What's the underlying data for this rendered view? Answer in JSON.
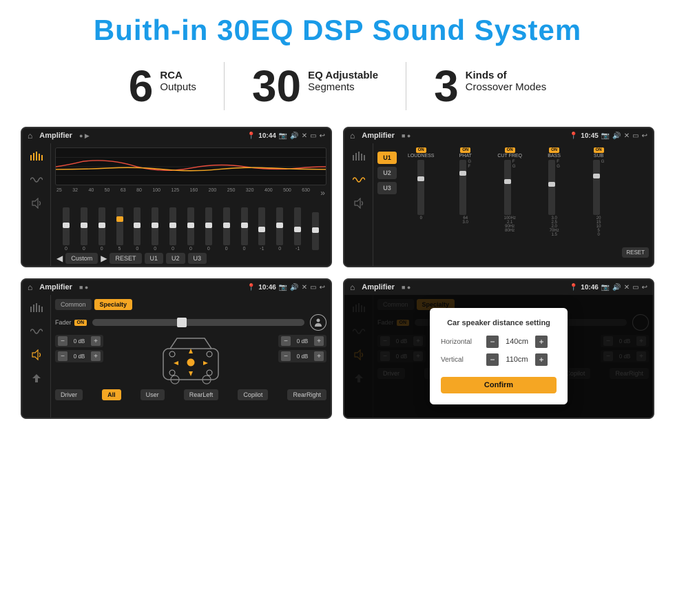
{
  "header": {
    "title": "Buith-in 30EQ DSP Sound System"
  },
  "stats": [
    {
      "number": "6",
      "label_main": "RCA",
      "label_sub": "Outputs"
    },
    {
      "number": "30",
      "label_main": "EQ Adjustable",
      "label_sub": "Segments"
    },
    {
      "number": "3",
      "label_main": "Kinds of",
      "label_sub": "Crossover Modes"
    }
  ],
  "screens": [
    {
      "id": "screen1",
      "title": "Amplifier",
      "time": "10:44",
      "description": "EQ Sliders Screen"
    },
    {
      "id": "screen2",
      "title": "Amplifier",
      "time": "10:45",
      "description": "Crossover Channels Screen"
    },
    {
      "id": "screen3",
      "title": "Amplifier",
      "time": "10:46",
      "description": "Fader Common Screen"
    },
    {
      "id": "screen4",
      "title": "Amplifier",
      "time": "10:46",
      "description": "Car Speaker Distance Setting Dialog"
    }
  ],
  "eq": {
    "frequencies": [
      "25",
      "32",
      "40",
      "50",
      "63",
      "80",
      "100",
      "125",
      "160",
      "200",
      "250",
      "320",
      "400",
      "500",
      "630"
    ],
    "values": [
      "0",
      "0",
      "0",
      "5",
      "0",
      "0",
      "0",
      "0",
      "0",
      "0",
      "0",
      "-1",
      "0",
      "-1",
      ""
    ],
    "custom_label": "Custom",
    "reset_label": "RESET",
    "u1_label": "U1",
    "u2_label": "U2",
    "u3_label": "U3"
  },
  "crossover": {
    "presets": [
      "U1",
      "U2",
      "U3"
    ],
    "channels": [
      "LOUDNESS",
      "PHAT",
      "CUT FREQ",
      "BASS",
      "SUB"
    ],
    "toggles": [
      "ON",
      "ON",
      "ON",
      "ON",
      "ON"
    ],
    "reset_label": "RESET"
  },
  "fader": {
    "tabs": [
      "Common",
      "Specialty"
    ],
    "label": "Fader",
    "on_badge": "ON",
    "db_values": [
      "0 dB",
      "0 dB",
      "0 dB",
      "0 dB"
    ],
    "bottom_btns": [
      "Driver",
      "All",
      "User",
      "RearRight",
      "RearLeft",
      "Copilot"
    ]
  },
  "dialog": {
    "title": "Car speaker distance setting",
    "horizontal_label": "Horizontal",
    "horizontal_value": "140cm",
    "vertical_label": "Vertical",
    "vertical_value": "110cm",
    "confirm_label": "Confirm"
  },
  "colors": {
    "accent": "#f5a623",
    "title_blue": "#1a9be8",
    "screen_bg": "#1a1a1a",
    "dark_bg": "#111"
  }
}
